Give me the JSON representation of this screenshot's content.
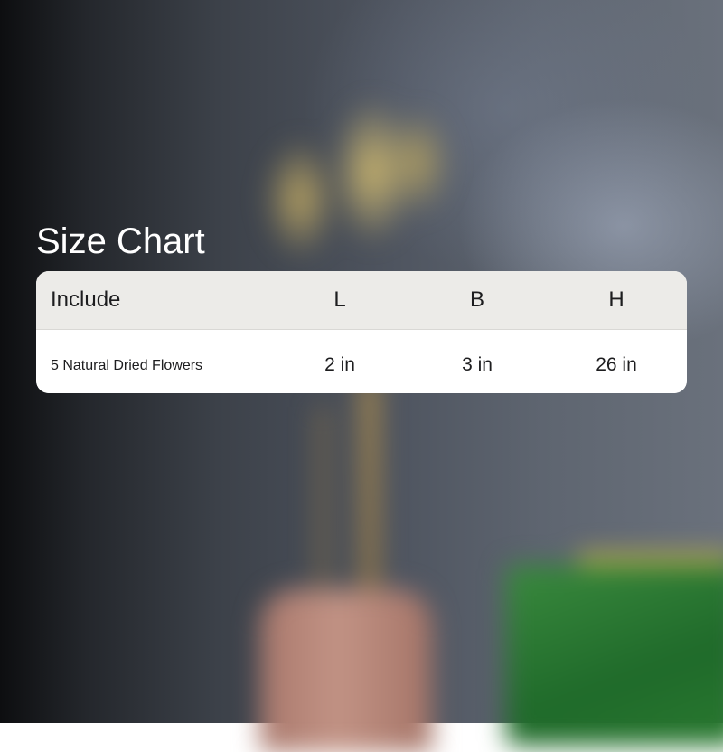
{
  "title": "Size Chart",
  "table": {
    "headers": [
      "Include",
      "L",
      "B",
      "H"
    ],
    "rows": [
      [
        "5 Natural Dried Flowers",
        "2 in",
        "3 in",
        "26 in"
      ]
    ]
  }
}
